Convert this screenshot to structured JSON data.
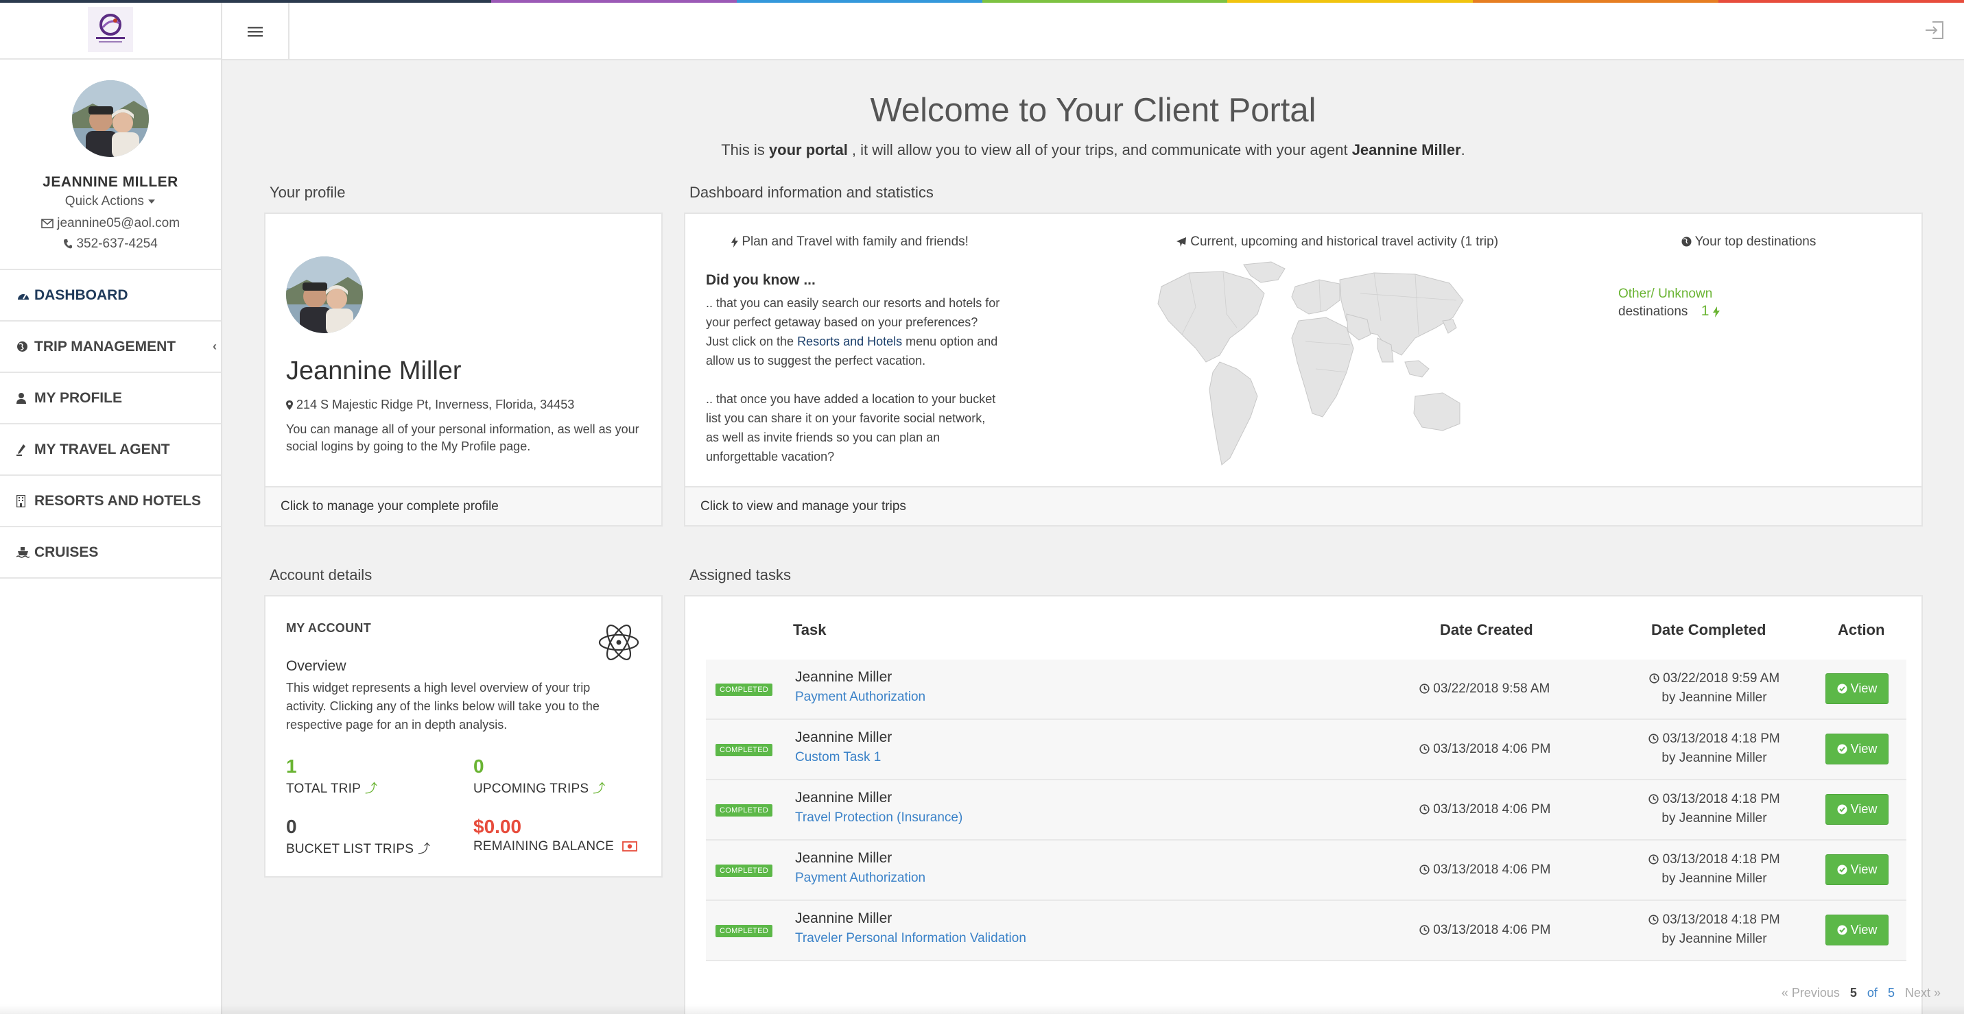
{
  "colors": {
    "rainbow": [
      "#2b3a4e",
      "#2b3a4e",
      "#9b59b6",
      "#3498db",
      "#7dc242",
      "#f1c40f",
      "#e67e22",
      "#e74c3c"
    ],
    "green": "#5cb848",
    "link_blue": "#3b82c8",
    "balance_red": "#e74c3c"
  },
  "sidebar": {
    "logo_icon": "agency-logo-icon",
    "user_name": "JEANNINE MILLER",
    "quick_actions": "Quick Actions",
    "email": "jeannine05@aol.com",
    "phone": "352-637-4254",
    "nav": [
      {
        "label": "DASHBOARD",
        "icon": "tachometer-icon",
        "active": true
      },
      {
        "label": "TRIP MANAGEMENT",
        "icon": "globe-icon"
      },
      {
        "label": "MY PROFILE",
        "icon": "user-icon"
      },
      {
        "label": "MY TRAVEL AGENT",
        "icon": "pen-icon"
      },
      {
        "label": "RESORTS AND HOTELS",
        "icon": "building-icon"
      },
      {
        "label": "CRUISES",
        "icon": "ship-icon"
      }
    ]
  },
  "header": {
    "menu_icon": "hamburger-icon",
    "logout_icon": "sign-out-icon"
  },
  "welcome": {
    "title": "Welcome to Your Client Portal",
    "sub_1": "This is ",
    "sub_bold_1": "your portal",
    "sub_2": " , it will allow you to view all of your trips, and communicate with your agent ",
    "sub_bold_2": "Jeannine Miller",
    "sub_3": "."
  },
  "profile": {
    "section_title": "Your profile",
    "name": "Jeannine Miller",
    "address": "214 S Majestic Ridge Pt, Inverness, Florida, 34453",
    "description": "You can manage all of your personal information, as well as your social logins by going to the My Profile page.",
    "footer": "Click to manage your complete profile"
  },
  "stats": {
    "section_title": "Dashboard information and statistics",
    "col1_title": "Plan and Travel with family and friends!",
    "col2_title": "Current, upcoming and historical travel activity (1 trip)",
    "col3_title": "Your top destinations",
    "did_you_know": "Did you know ...",
    "tip1_a": ".. that you can easily search our resorts and hotels for your perfect getaway based on your preferences? Just click on the ",
    "tip1_link": "Resorts and Hotels",
    "tip1_b": " menu option and allow us to suggest the perfect vacation.",
    "tip2": ".. that once you have added a location to your bucket list you can share it on your favorite social network, as well as invite friends so you can plan an unforgettable vacation?",
    "dest_name": "Other/ Unknown",
    "dest_label": "destinations",
    "dest_count": "1",
    "footer": "Click to view and manage your trips"
  },
  "account": {
    "section_title": "Account details",
    "heading": "MY ACCOUNT",
    "overview": "Overview",
    "description": "This widget represents a high level overview of your trip activity. Clicking any of the links below will take you to the respective page for an in depth analysis.",
    "total_trip_value": "1",
    "total_trip_label": "TOTAL TRIP",
    "upcoming_value": "0",
    "upcoming_label": "UPCOMING TRIPS",
    "bucket_value": "0",
    "bucket_label": "BUCKET LIST TRIPS",
    "balance_value": "$0.00",
    "balance_label": "REMAINING BALANCE"
  },
  "tasks": {
    "section_title": "Assigned tasks",
    "headers": {
      "task": "Task",
      "created": "Date Created",
      "completed": "Date Completed",
      "action": "Action"
    },
    "rows": [
      {
        "status": "COMPLETED",
        "name": "Jeannine Miller",
        "task": "Payment Authorization",
        "created": "03/22/2018 9:58 AM",
        "completed": "03/22/2018 9:59 AM",
        "by": "by Jeannine Miller",
        "action": "View"
      },
      {
        "status": "COMPLETED",
        "name": "Jeannine Miller",
        "task": "Custom Task 1",
        "created": "03/13/2018 4:06 PM",
        "completed": "03/13/2018 4:18 PM",
        "by": "by Jeannine Miller",
        "action": "View"
      },
      {
        "status": "COMPLETED",
        "name": "Jeannine Miller",
        "task": "Travel Protection (Insurance)",
        "created": "03/13/2018 4:06 PM",
        "completed": "03/13/2018 4:18 PM",
        "by": "by Jeannine Miller",
        "action": "View"
      },
      {
        "status": "COMPLETED",
        "name": "Jeannine Miller",
        "task": "Payment Authorization",
        "created": "03/13/2018 4:06 PM",
        "completed": "03/13/2018 4:18 PM",
        "by": "by Jeannine Miller",
        "action": "View"
      },
      {
        "status": "COMPLETED",
        "name": "Jeannine Miller",
        "task": "Traveler Personal Information Validation",
        "created": "03/13/2018 4:06 PM",
        "completed": "03/13/2018 4:18 PM",
        "by": "by Jeannine Miller",
        "action": "View"
      }
    ],
    "pager": {
      "prev": "« Previous",
      "current": "5",
      "of": "of",
      "total": "5",
      "next": "Next »"
    }
  }
}
